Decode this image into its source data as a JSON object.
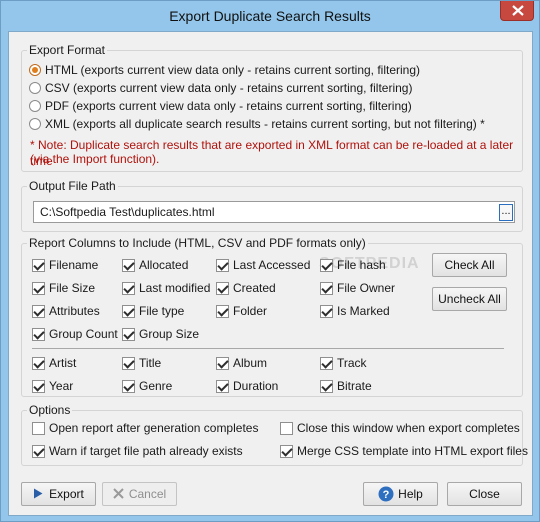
{
  "window": {
    "title": "Export Duplicate Search Results"
  },
  "export_format": {
    "label": "Export Format",
    "options": [
      {
        "label": "HTML (exports current view data only - retains current sorting, filtering)",
        "selected": true
      },
      {
        "label": "CSV (exports current view data only - retains current sorting, filtering)",
        "selected": false
      },
      {
        "label": "PDF (exports current view data only - retains current sorting, filtering)",
        "selected": false
      },
      {
        "label": "XML (exports all duplicate search results - retains current sorting, but not filtering) *",
        "selected": false
      }
    ],
    "note_line1": "* Note: Duplicate search results that are exported in XML format can be re-loaded at a later time",
    "note_line2": "(via the Import function)."
  },
  "output_file": {
    "label": "Output File Path",
    "value": "C:\\Softpedia Test\\duplicates.html",
    "browse_label": "..."
  },
  "report_columns": {
    "label": "Report Columns to Include (HTML, CSV and PDF formats only)",
    "items": [
      {
        "label": "Filename",
        "checked": true
      },
      {
        "label": "Allocated",
        "checked": true
      },
      {
        "label": "Last Accessed",
        "checked": true
      },
      {
        "label": "File hash",
        "checked": true
      },
      {
        "label": "File Size",
        "checked": true
      },
      {
        "label": "Last modified",
        "checked": true
      },
      {
        "label": "Created",
        "checked": true
      },
      {
        "label": "File Owner",
        "checked": true
      },
      {
        "label": "Attributes",
        "checked": true
      },
      {
        "label": "File type",
        "checked": true
      },
      {
        "label": "Folder",
        "checked": true
      },
      {
        "label": "Is Marked",
        "checked": true
      },
      {
        "label": "Group Count",
        "checked": true
      },
      {
        "label": "Group Size",
        "checked": true
      },
      {
        "label": "Artist",
        "checked": true
      },
      {
        "label": "Title",
        "checked": true
      },
      {
        "label": "Album",
        "checked": true
      },
      {
        "label": "Track",
        "checked": true
      },
      {
        "label": "Year",
        "checked": true
      },
      {
        "label": "Genre",
        "checked": true
      },
      {
        "label": "Duration",
        "checked": true
      },
      {
        "label": "Bitrate",
        "checked": true
      }
    ],
    "check_all": "Check All",
    "uncheck_all": "Uncheck All",
    "watermark": "SOFTPEDIA"
  },
  "options": {
    "label": "Options",
    "items": [
      {
        "label": "Open report after generation completes",
        "checked": false
      },
      {
        "label": "Close this window when export completes",
        "checked": false
      },
      {
        "label": "Warn if target file path already exists",
        "checked": true
      },
      {
        "label": "Merge CSS template into HTML export files",
        "checked": true
      }
    ]
  },
  "footer": {
    "export": "Export",
    "cancel": "Cancel",
    "help": "Help",
    "close": "Close"
  },
  "colors": {
    "titlebar": "#93c6ea",
    "close_button": "#c7483f",
    "note_text": "#b0120c",
    "export_icon": "#2a5fa8",
    "help_icon": "#2f6fc0"
  },
  "icons": {
    "close": "close-icon",
    "export": "play-arrow-icon",
    "cancel": "x-icon",
    "help": "question-icon"
  }
}
